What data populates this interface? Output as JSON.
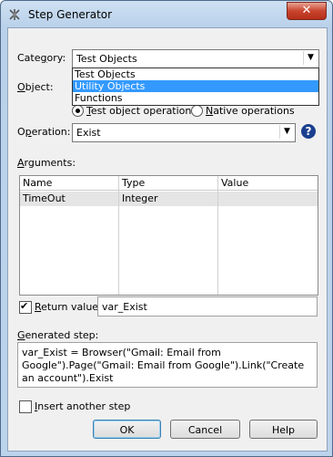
{
  "window": {
    "title": "Step Generator",
    "close_glyph": "✕"
  },
  "category": {
    "label_pre": "Cate",
    "label_u": "g",
    "label_post": "ory:",
    "value": "Test Objects",
    "options": [
      "Test Objects",
      "Utility Objects",
      "Functions"
    ],
    "highlighted": "Utility Objects"
  },
  "object": {
    "label_pre": "",
    "label_u": "O",
    "label_post": "bject:"
  },
  "operation_type": {
    "test_object": {
      "label_pre": "",
      "label_u": "T",
      "label_post": "est object operations",
      "selected": true
    },
    "native": {
      "label_pre": "",
      "label_u": "N",
      "label_post": "ative operations",
      "selected": false
    }
  },
  "operation": {
    "label_pre": "O",
    "label_u": "p",
    "label_post": "eration:",
    "value": "Exist",
    "help_glyph": "?"
  },
  "arguments": {
    "label_pre": "",
    "label_u": "A",
    "label_post": "rguments:",
    "columns": [
      "Name",
      "Type",
      "Value"
    ],
    "rows": [
      {
        "name": "TimeOut",
        "type": "Integer",
        "value": ""
      }
    ]
  },
  "return_value": {
    "label_pre": "",
    "label_u": "R",
    "label_post": "eturn value",
    "checked": true,
    "value": "var_Exist"
  },
  "generated_step": {
    "label_pre": "",
    "label_u": "G",
    "label_post": "enerated step:",
    "text": "var_Exist = Browser(\"Gmail: Email from Google\").Page(\"Gmail: Email from Google\").Link(\"Create an account\").Exist"
  },
  "insert_another": {
    "label_pre": "",
    "label_u": "I",
    "label_post": "nsert another step",
    "checked": false
  },
  "buttons": {
    "ok": "OK",
    "cancel": "Cancel",
    "help": "Help"
  },
  "icons": {
    "app": "step-generator-icon",
    "dropdown_arrow": "▼"
  },
  "colors": {
    "selection": "#3399ff",
    "close": "#c8452e",
    "help_icon": "#1a3f8f"
  }
}
